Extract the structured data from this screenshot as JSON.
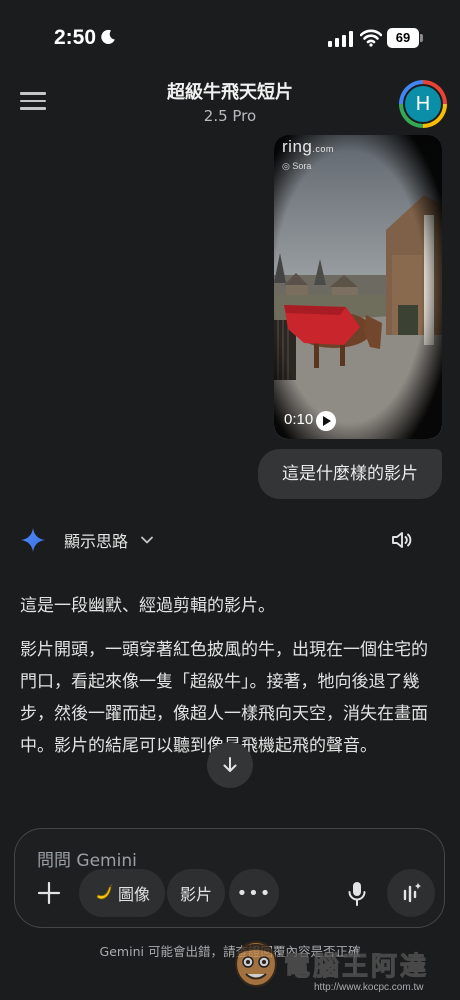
{
  "status_bar": {
    "time": "2:50",
    "battery": "69",
    "icons": [
      "moon-icon",
      "signal-icon",
      "wifi-icon",
      "battery-icon"
    ]
  },
  "header": {
    "title": "超級牛飛天短片",
    "model": "2.5 Pro",
    "avatar_initial": "H",
    "menu_icon": "hamburger-menu-icon"
  },
  "video": {
    "brand": "ring",
    "brand_suffix": ".com",
    "tag": "Sora",
    "duration": "0:10"
  },
  "user_message": "這是什麼樣的影片",
  "thinking": {
    "label": "顯示思路"
  },
  "response": {
    "paragraphs": [
      "這是一段幽默、經過剪輯的影片。",
      "影片開頭，一頭穿著紅色披風的牛，出現在一個住宅的門口，看起來像一隻「超級牛」。接著，牠向後退了幾步，然後一躍而起，像超人一樣飛向天空，消失在畫面中。影片的結尾可以聽到像是飛機起飛的聲音。"
    ]
  },
  "composer": {
    "placeholder": "問問 Gemini",
    "image_chip": "圖像",
    "video_chip": "影片",
    "more_chip": "•••"
  },
  "disclaimer": "Gemini 可能會出錯，請查證回覆內容是否正確",
  "watermark": {
    "name": "電腦王阿達",
    "url": "http://www.kocpc.com.tw"
  },
  "colors": {
    "background": "#1b1c1d",
    "bubble": "#333537",
    "accent_spark": "#4285f4",
    "avatar": "#0b8fa8"
  }
}
